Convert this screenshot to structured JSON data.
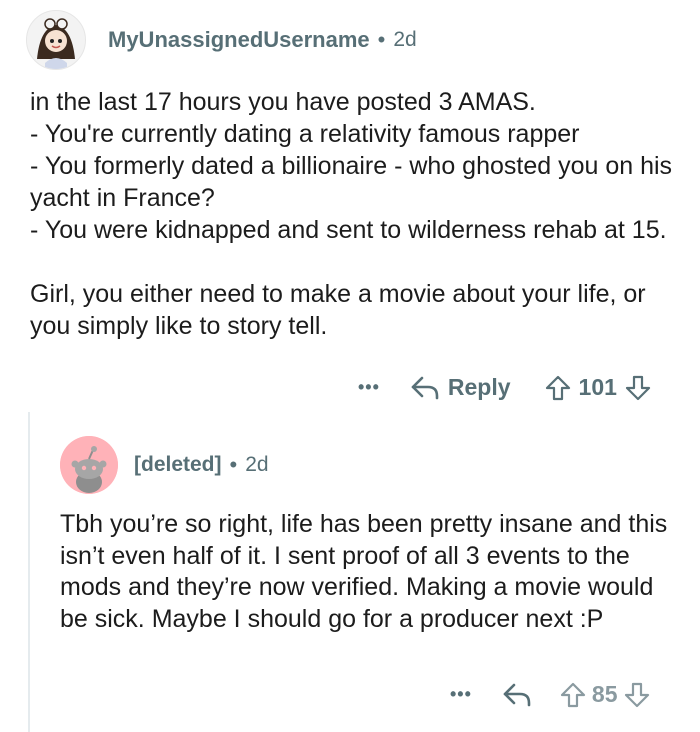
{
  "comments": [
    {
      "username": "MyUnassignedUsername",
      "dot": "•",
      "time": "2d",
      "paragraphs": [
        "in the last 17 hours you have posted 3 AMAS.",
        "- You're currently dating a relativity famous rapper",
        "- You formerly dated a billionaire - who ghosted you on his yacht in France?",
        "- You were kidnapped and sent to wilderness rehab at 15.",
        "",
        "Girl, you either need to make a movie about your life, or you simply like to story tell."
      ],
      "more": "•••",
      "reply_label": "Reply",
      "score": "101"
    },
    {
      "username": "[deleted]",
      "dot": "•",
      "time": "2d",
      "paragraphs": [
        "Tbh you’re so right, life has been pretty insane and this isn’t even half of it. I sent proof of all 3 events to the mods and they’re now verified. Making a movie would be sick. Maybe I should go for a producer next :P"
      ],
      "more": "•••",
      "score": "85"
    }
  ],
  "colors": {
    "text": "#1c1c1c",
    "meta": "#576f76",
    "deleted_avatar_bg": "#ffb2b8",
    "thread_line": "#e5ebee"
  }
}
